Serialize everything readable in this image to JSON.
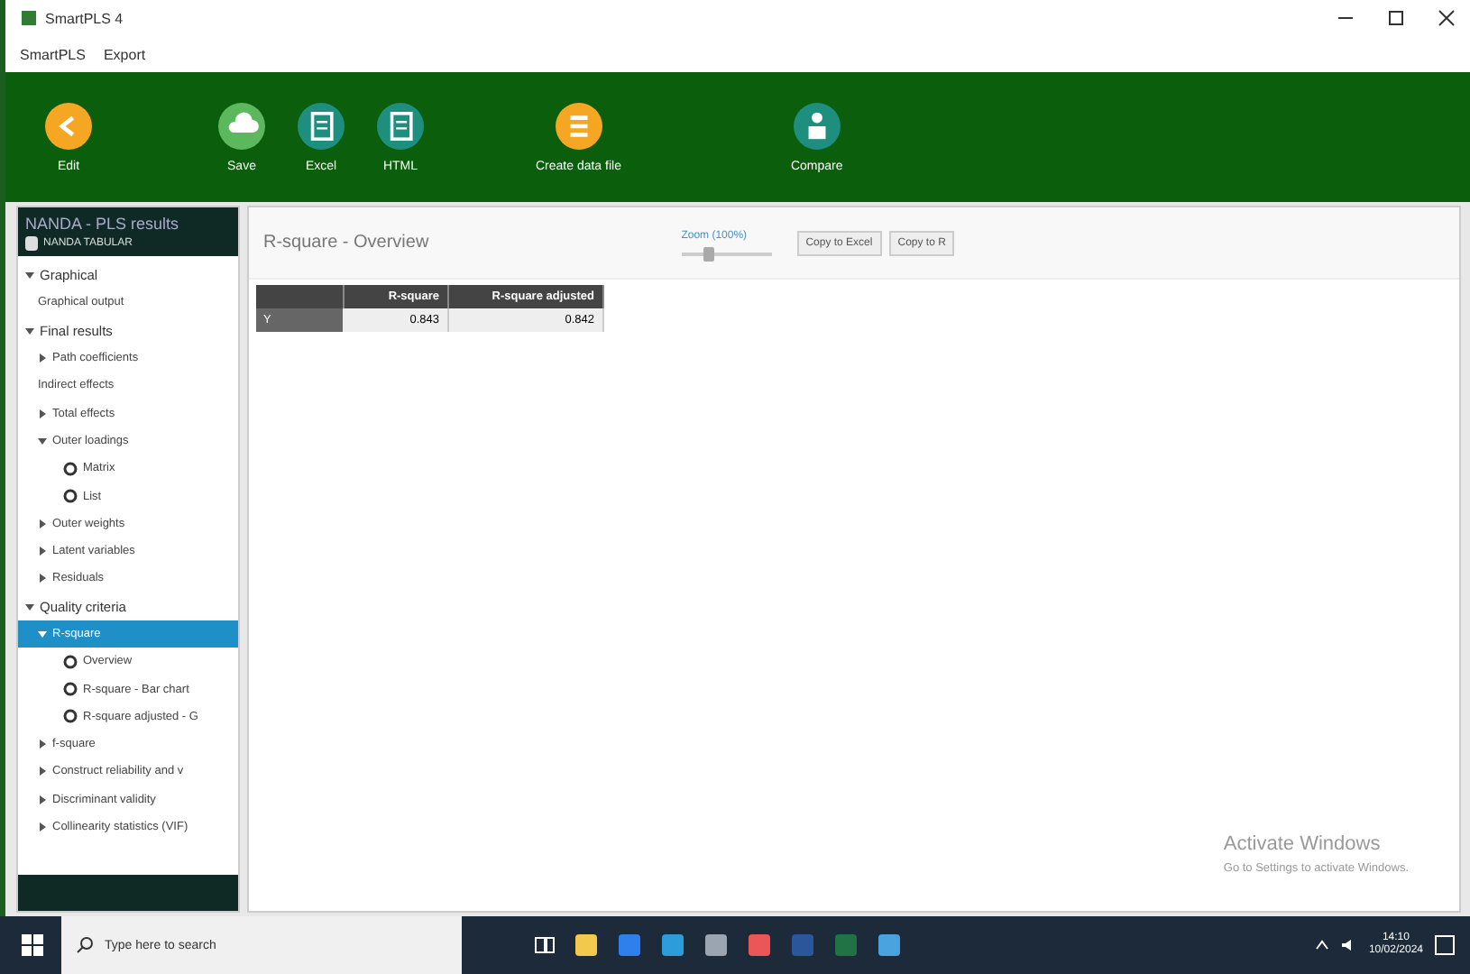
{
  "window": {
    "title": "SmartPLS 4"
  },
  "menu": [
    "SmartPLS",
    "Export"
  ],
  "toolbar": {
    "groups": [
      [
        {
          "label": "Edit",
          "color": "#f5a623"
        }
      ],
      [
        {
          "label": "Save",
          "color": "#5cb85c"
        },
        {
          "label": "Excel",
          "color": "#1e8e7e"
        },
        {
          "label": "HTML",
          "color": "#1e8e7e"
        }
      ],
      [
        {
          "label": "Create data file",
          "color": "#f5a623"
        }
      ],
      [
        {
          "label": "Compare",
          "color": "#1e8e7e"
        }
      ]
    ]
  },
  "sidebar": {
    "title": "NANDA - PLS results",
    "subtitle": "NANDA TABULAR",
    "tree": [
      {
        "label": "Graphical",
        "kind": "group",
        "expanded": true,
        "selected": false,
        "children": [
          {
            "label": "Graphical output",
            "kind": "leaf",
            "selected": false
          }
        ]
      },
      {
        "label": "Final results",
        "kind": "group",
        "expanded": true,
        "selected": false,
        "children": [
          {
            "label": "Path coefficients",
            "kind": "branch",
            "expanded": false,
            "selected": false
          },
          {
            "label": "Indirect effects",
            "kind": "leaf",
            "selected": false
          },
          {
            "label": "Total effects",
            "kind": "branch",
            "expanded": false,
            "selected": false
          },
          {
            "label": "Outer loadings",
            "kind": "branch",
            "expanded": true,
            "selected": false,
            "children": [
              {
                "label": "Matrix",
                "kind": "radio",
                "selected": false
              },
              {
                "label": "List",
                "kind": "radio",
                "selected": false
              }
            ]
          },
          {
            "label": "Outer weights",
            "kind": "branch",
            "expanded": false,
            "selected": false
          },
          {
            "label": "Latent variables",
            "kind": "branch",
            "expanded": false,
            "selected": false
          },
          {
            "label": "Residuals",
            "kind": "branch",
            "expanded": false,
            "selected": false
          }
        ]
      },
      {
        "label": "Quality criteria",
        "kind": "group",
        "expanded": true,
        "selected": false,
        "children": [
          {
            "label": "R-square",
            "kind": "branch",
            "expanded": true,
            "selected": true,
            "children": [
              {
                "label": "Overview",
                "kind": "radio",
                "selected": false
              },
              {
                "label": "R-square - Bar chart",
                "kind": "radio",
                "selected": false
              },
              {
                "label": "R-square adjusted - G",
                "kind": "radio",
                "selected": false
              }
            ]
          },
          {
            "label": "f-square",
            "kind": "branch",
            "expanded": false,
            "selected": false
          },
          {
            "label": "Construct reliability and v",
            "kind": "branch",
            "expanded": false,
            "selected": false
          },
          {
            "label": "Discriminant validity",
            "kind": "branch",
            "expanded": false,
            "selected": false
          },
          {
            "label": "Collinearity statistics (VIF)",
            "kind": "branch",
            "expanded": false,
            "selected": false
          }
        ]
      }
    ]
  },
  "main": {
    "title": "R-square - Overview",
    "zoom": {
      "label": "Zoom (100%)",
      "level": 0.25
    },
    "buttons": [
      "Copy to Excel",
      "Copy to R"
    ],
    "table": {
      "columns": [
        "R-square",
        "R-square adjusted"
      ],
      "rows": [
        {
          "label": "Y",
          "cells": [
            "0.843",
            "0.842"
          ]
        }
      ]
    }
  },
  "watermark_os": {
    "title": "Activate Windows",
    "text": "Go to Settings to activate Windows."
  },
  "taskbar": {
    "search": {
      "placeholder": "Type here to search"
    },
    "apps": [
      {
        "color": "#f2c94c"
      },
      {
        "color": "#2f80ed"
      },
      {
        "color": "#2d9cdb"
      },
      {
        "color": "#9aa5b1"
      },
      {
        "color": "#eb5757"
      },
      {
        "color": "#2b579a"
      },
      {
        "color": "#217346"
      },
      {
        "color": "#4aa3df"
      }
    ],
    "time": "14:10",
    "date": "10/02/2024"
  }
}
